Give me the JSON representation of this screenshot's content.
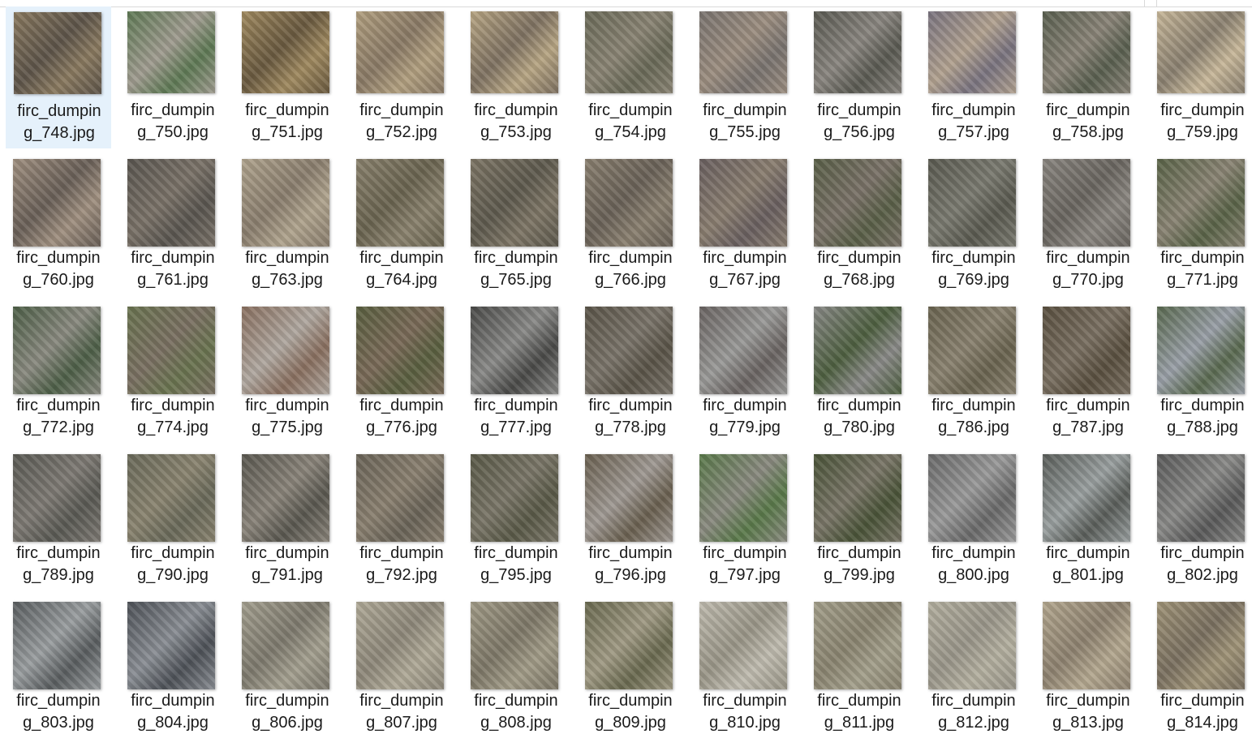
{
  "window": {
    "selected_index": 0
  },
  "files": [
    {
      "name": "firc_dumping_748.jpg",
      "tone": [
        "#8a7a60",
        "#5e554a"
      ]
    },
    {
      "name": "firc_dumping_750.jpg",
      "tone": [
        "#5f7a55",
        "#a09c90"
      ]
    },
    {
      "name": "firc_dumping_751.jpg",
      "tone": [
        "#a08a60",
        "#6a5a40"
      ]
    },
    {
      "name": "firc_dumping_752.jpg",
      "tone": [
        "#b2a080",
        "#8a7a66"
      ]
    },
    {
      "name": "firc_dumping_753.jpg",
      "tone": [
        "#b8a684",
        "#7f7262"
      ]
    },
    {
      "name": "firc_dumping_754.jpg",
      "tone": [
        "#6a6a58",
        "#8a8474"
      ]
    },
    {
      "name": "firc_dumping_755.jpg",
      "tone": [
        "#7a7470",
        "#9c8e80"
      ]
    },
    {
      "name": "firc_dumping_756.jpg",
      "tone": [
        "#5a5a52",
        "#8a8680"
      ]
    },
    {
      "name": "firc_dumping_757.jpg",
      "tone": [
        "#7a7480",
        "#b2a290"
      ]
    },
    {
      "name": "firc_dumping_758.jpg",
      "tone": [
        "#5a6050",
        "#8a8478"
      ]
    },
    {
      "name": "firc_dumping_759.jpg",
      "tone": [
        "#c8b89a",
        "#8a8070"
      ]
    },
    {
      "name": "firc_dumping_760.jpg",
      "tone": [
        "#a09080",
        "#6a6058"
      ]
    },
    {
      "name": "firc_dumping_761.jpg",
      "tone": [
        "#5a5650",
        "#7a7268"
      ]
    },
    {
      "name": "firc_dumping_763.jpg",
      "tone": [
        "#b0a48e",
        "#8a7e6e"
      ]
    },
    {
      "name": "firc_dumping_764.jpg",
      "tone": [
        "#8a826e",
        "#6a6450"
      ]
    },
    {
      "name": "firc_dumping_765.jpg",
      "tone": [
        "#7e7666",
        "#5e5a4e"
      ]
    },
    {
      "name": "firc_dumping_766.jpg",
      "tone": [
        "#8a8070",
        "#6a6258"
      ]
    },
    {
      "name": "firc_dumping_767.jpg",
      "tone": [
        "#6a6060",
        "#8a7e70"
      ]
    },
    {
      "name": "firc_dumping_768.jpg",
      "tone": [
        "#5a6048",
        "#7a7268"
      ]
    },
    {
      "name": "firc_dumping_769.jpg",
      "tone": [
        "#5a5a50",
        "#7a7a70"
      ]
    },
    {
      "name": "firc_dumping_770.jpg",
      "tone": [
        "#8a8680",
        "#6a6660"
      ]
    },
    {
      "name": "firc_dumping_771.jpg",
      "tone": [
        "#5a6448",
        "#8a8474"
      ]
    },
    {
      "name": "firc_dumping_772.jpg",
      "tone": [
        "#4e6048",
        "#8a8a80"
      ]
    },
    {
      "name": "firc_dumping_774.jpg",
      "tone": [
        "#6a7450",
        "#7a7062"
      ]
    },
    {
      "name": "firc_dumping_775.jpg",
      "tone": [
        "#8a7060",
        "#b0a8a0"
      ]
    },
    {
      "name": "firc_dumping_776.jpg",
      "tone": [
        "#5a6040",
        "#7a6a58"
      ]
    },
    {
      "name": "firc_dumping_777.jpg",
      "tone": [
        "#4a4a48",
        "#8a8a88"
      ]
    },
    {
      "name": "firc_dumping_778.jpg",
      "tone": [
        "#5a5448",
        "#7a746a"
      ]
    },
    {
      "name": "firc_dumping_779.jpg",
      "tone": [
        "#6a6462",
        "#9a9a98"
      ]
    },
    {
      "name": "firc_dumping_780.jpg",
      "tone": [
        "#8a8a88",
        "#4e6040"
      ]
    },
    {
      "name": "firc_dumping_786.jpg",
      "tone": [
        "#6a6450",
        "#8a8270"
      ]
    },
    {
      "name": "firc_dumping_787.jpg",
      "tone": [
        "#5a5040",
        "#7a7062"
      ]
    },
    {
      "name": "firc_dumping_788.jpg",
      "tone": [
        "#5a6a50",
        "#9aa0a8"
      ]
    },
    {
      "name": "firc_dumping_789.jpg",
      "tone": [
        "#5a5a54",
        "#7e7a74"
      ]
    },
    {
      "name": "firc_dumping_790.jpg",
      "tone": [
        "#6a6a5a",
        "#8a8470"
      ]
    },
    {
      "name": "firc_dumping_791.jpg",
      "tone": [
        "#5a5850",
        "#8a847a"
      ]
    },
    {
      "name": "firc_dumping_792.jpg",
      "tone": [
        "#6a6458",
        "#8a8070"
      ]
    },
    {
      "name": "firc_dumping_795.jpg",
      "tone": [
        "#5a5a48",
        "#7a7668"
      ]
    },
    {
      "name": "firc_dumping_796.jpg",
      "tone": [
        "#6a6050",
        "#a09a94"
      ]
    },
    {
      "name": "firc_dumping_797.jpg",
      "tone": [
        "#5a7a4a",
        "#8a8a80"
      ]
    },
    {
      "name": "firc_dumping_799.jpg",
      "tone": [
        "#4a5438",
        "#7a7668"
      ]
    },
    {
      "name": "firc_dumping_800.jpg",
      "tone": [
        "#6a6a6a",
        "#9a9a9a"
      ]
    },
    {
      "name": "firc_dumping_801.jpg",
      "tone": [
        "#5a5e5a",
        "#9aa0a0"
      ]
    },
    {
      "name": "firc_dumping_802.jpg",
      "tone": [
        "#5a5a5a",
        "#8a8a88"
      ]
    },
    {
      "name": "firc_dumping_803.jpg",
      "tone": [
        "#5a5e60",
        "#9a9ea0"
      ]
    },
    {
      "name": "firc_dumping_804.jpg",
      "tone": [
        "#4e5258",
        "#8a8e94"
      ]
    },
    {
      "name": "firc_dumping_806.jpg",
      "tone": [
        "#a4a090",
        "#7e7a6e"
      ]
    },
    {
      "name": "firc_dumping_807.jpg",
      "tone": [
        "#b0aa98",
        "#8e887a"
      ]
    },
    {
      "name": "firc_dumping_808.jpg",
      "tone": [
        "#a29c88",
        "#7e7868"
      ]
    },
    {
      "name": "firc_dumping_809.jpg",
      "tone": [
        "#6a6a50",
        "#a09a84"
      ]
    },
    {
      "name": "firc_dumping_810.jpg",
      "tone": [
        "#c0bcb0",
        "#9a9688"
      ]
    },
    {
      "name": "firc_dumping_811.jpg",
      "tone": [
        "#a4a08c",
        "#8a8470"
      ]
    },
    {
      "name": "firc_dumping_812.jpg",
      "tone": [
        "#b4b0a0",
        "#9a968a"
      ]
    },
    {
      "name": "firc_dumping_813.jpg",
      "tone": [
        "#b4a890",
        "#8e8270"
      ]
    },
    {
      "name": "firc_dumping_814.jpg",
      "tone": [
        "#a09478",
        "#7a7060"
      ]
    }
  ]
}
